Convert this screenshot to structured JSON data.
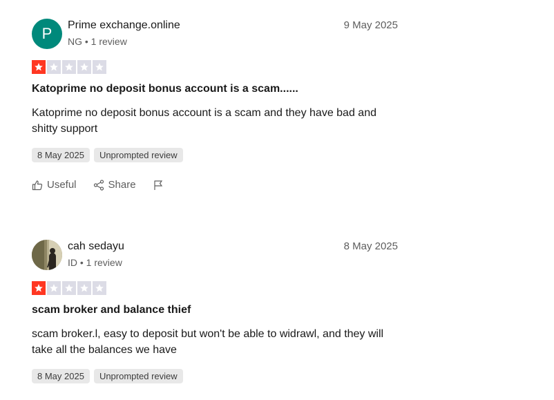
{
  "reviews": [
    {
      "avatar": {
        "type": "letter",
        "letter": "P",
        "color": "#00897b"
      },
      "user_name": "Prime exchange.online",
      "user_meta": "NG • 1 review",
      "date": "9 May 2025",
      "rating": 1,
      "title": "Katoprime no deposit bonus account is a scam......",
      "body": "Katoprime no deposit bonus account is a scam and they have bad and shitty support",
      "tags": {
        "experience_date": "8 May 2025",
        "type": "Unprompted review"
      },
      "actions": {
        "useful": "Useful",
        "share": "Share"
      }
    },
    {
      "avatar": {
        "type": "photo"
      },
      "user_name": "cah sedayu",
      "user_meta": "ID • 1 review",
      "date": "8 May 2025",
      "rating": 1,
      "title": "scam broker and balance thief",
      "body": "scam broker.l, easy to deposit but won't be able to widrawl, and they will take all the balances we have",
      "tags": {
        "experience_date": "8 May 2025",
        "type": "Unprompted review"
      }
    }
  ],
  "colors": {
    "star_filled": "#ff3722",
    "star_empty": "#dcdce6",
    "tag_bg": "#e8e8e8"
  }
}
